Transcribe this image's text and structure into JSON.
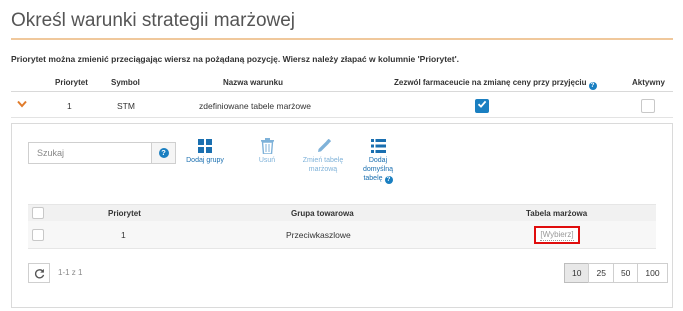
{
  "page": {
    "title": "Określ warunki strategii marżowej"
  },
  "info_text": "Priorytet można zmienić przeciągając wiersz na pożądaną pozycję. Wiersz należy złapać w kolumnie 'Priorytet'.",
  "main_table": {
    "headers": {
      "priority": "Priorytet",
      "symbol": "Symbol",
      "name": "Nazwa warunku",
      "allow_change": "Zezwól farmaceucie na zmianę ceny przy przyjęciu",
      "active": "Aktywny"
    },
    "rows": [
      {
        "priority": "1",
        "symbol": "STM",
        "name": "zdefiniowane tabele marżowe",
        "allow_change": true,
        "active": false
      }
    ]
  },
  "subpanel": {
    "search": {
      "placeholder": "Szukaj",
      "help_glyph": "?"
    },
    "toolbar": {
      "add_groups": "Dodaj grupy",
      "delete": "Usuń",
      "change_table_line1": "Zmień tabelę",
      "change_table_line2": "marżową",
      "default_table_line1": "Dodaj",
      "default_table_line2": "domyślną",
      "default_table_line3": "tabelę"
    },
    "table": {
      "headers": {
        "priority": "Priorytet",
        "group": "Grupa towarowa",
        "margin_table": "Tabela marżowa"
      },
      "rows": [
        {
          "priority": "1",
          "group": "Przeciwkaszlowe",
          "select_link": "[Wybierz]"
        }
      ]
    },
    "pager": {
      "info": "1-1 z 1",
      "sizes": [
        "10",
        "25",
        "50",
        "100"
      ],
      "selected": "10"
    }
  },
  "colors": {
    "accent": "#1a7fc1",
    "orange": "#e07b2b",
    "highlight_red": "#e00d0d"
  }
}
